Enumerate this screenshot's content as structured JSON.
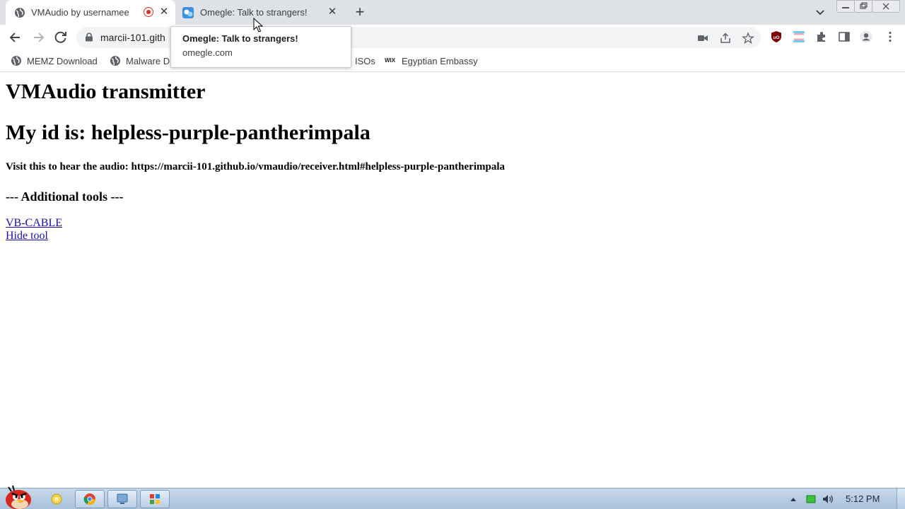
{
  "browser": {
    "tabs": [
      {
        "title": "VMAudio by usernamee",
        "active": true,
        "recording": true
      },
      {
        "title": "Omegle: Talk to strangers!",
        "active": false
      }
    ],
    "tooltip": {
      "title": "Omegle: Talk to strangers!",
      "domain": "omegle.com"
    },
    "address": {
      "url": "marcii-101.gith"
    },
    "bookmarks": [
      {
        "label": "MEMZ Download",
        "icon": "globe-icon"
      },
      {
        "label": "Malware D",
        "icon": "globe-icon"
      },
      {
        "label": "ISOs",
        "icon": "folder-icon"
      },
      {
        "label": "Egyptian Embassy",
        "icon": "wix-icon"
      }
    ],
    "wix_text": "WIX"
  },
  "page": {
    "title": "VMAudio transmitter",
    "id_heading": "My id is: helpless-purple-pantherimpala",
    "visit_text": "Visit this to hear the audio: https://marcii-101.github.io/vmaudio/receiver.html#helpless-purple-pantherimpala",
    "tools_heading": "--- Additional tools ---",
    "links": {
      "vb_cable": "VB-CABLE",
      "hide_tool": "Hide tool"
    }
  },
  "taskbar": {
    "clock": "5:12 PM",
    "apps": [
      "angry-birds-start-icon",
      "explorer-icon",
      "chrome-icon",
      "network-app-icon",
      "paint-app-icon"
    ]
  },
  "colors": {
    "tabstrip": "#dee1e6",
    "link": "#1a0dab",
    "taskbar": "#b9cde4",
    "record": "#d93025"
  }
}
